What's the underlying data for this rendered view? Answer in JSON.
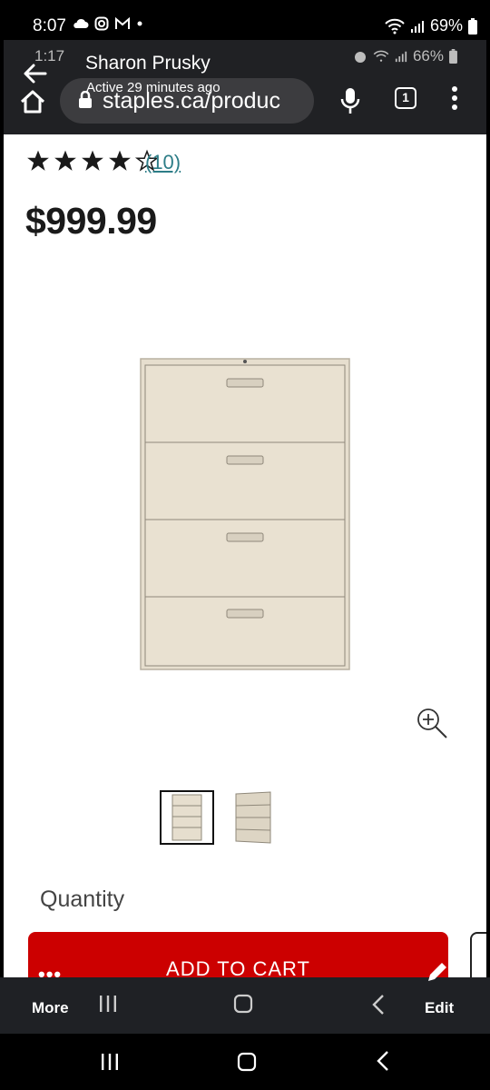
{
  "status_bar": {
    "time": "8:07",
    "battery": "69%",
    "icons": [
      "cloud-icon",
      "instagram-icon",
      "gmail-icon",
      "dot-icon",
      "wifi-icon",
      "signal-icon",
      "battery-icon"
    ]
  },
  "inner_status": {
    "time": "1:17",
    "battery": "66%"
  },
  "chat": {
    "name": "Sharon Prusky",
    "active": "Active 29 minutes ago"
  },
  "browser": {
    "url": "staples.ca/produc",
    "tab_count": "1"
  },
  "product": {
    "review_count": "(10)",
    "rating": 4,
    "rating_max": 5,
    "price": "$999.99",
    "quantity_label": "Quantity",
    "add_to_cart_label": "ADD TO CART"
  },
  "toolbar": {
    "more_label": "More",
    "edit_label": "Edit",
    "more_dots": "•••"
  },
  "colors": {
    "accent_red": "#cc0000",
    "link_teal": "#2d7d87",
    "cabinet_beige": "#e8e0d0"
  }
}
